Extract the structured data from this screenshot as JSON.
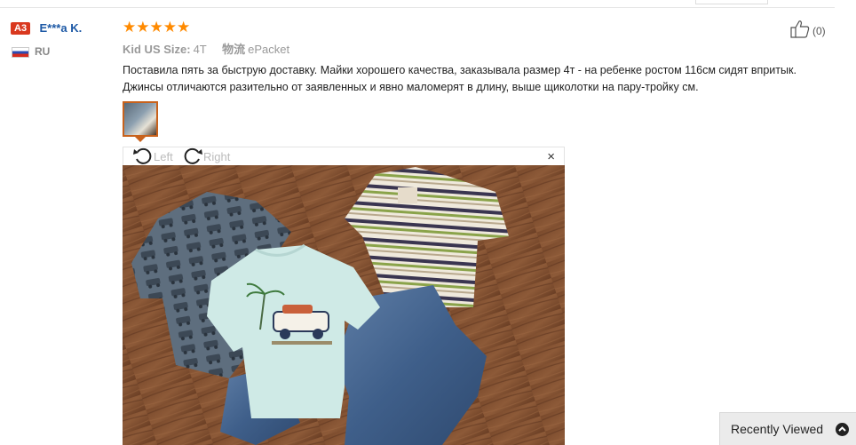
{
  "user": {
    "badge": "A3",
    "name": "E***a K.",
    "country": "RU"
  },
  "review": {
    "rating_stars": "★★★★★",
    "size_label": "Kid US Size:",
    "size_value": "4T",
    "shipping_label": "物流",
    "shipping_value": "ePacket",
    "text": "Поставила пять за быструю доставку. Майки хорошего качества, заказывала размер 4т - на ребенке ростом 116см сидят впритык. Джинсы отличаются разительно от заявленных и явно маломерят в длину, выше щиколотки на пару-тройку см.",
    "helpful_count": "(0)"
  },
  "viewer": {
    "rotate_left": "Left",
    "rotate_right": "Right",
    "close": "×"
  },
  "recently_viewed": "Recently Viewed",
  "colors": {
    "star": "#ff8a00",
    "username": "#1c58a5",
    "badge": "#d9381e",
    "thumb_border": "#c8621c"
  }
}
